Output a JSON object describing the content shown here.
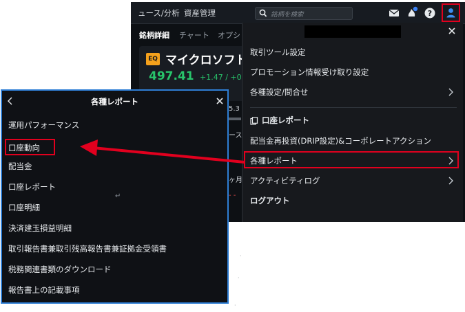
{
  "topbar": {
    "nav_items": [
      "ュース/分析",
      "資産管理"
    ],
    "search_placeholder": "銘柄を検索"
  },
  "subtabs": [
    "銘柄詳細",
    "チャート",
    "オプシ"
  ],
  "stock": {
    "badge": "EQ",
    "name": "マイクロソフト",
    "price": "497.41",
    "change": "+1.47 / +0.30"
  },
  "fragments": [
    "5.3",
    "ース",
    "ヶ月",
    "- -"
  ],
  "account_menu": {
    "items": [
      {
        "label": "取引ツール設定"
      },
      {
        "label": "プロモーション情報受け取り設定"
      },
      {
        "label": "各種設定/問合せ"
      }
    ],
    "section_title": "口座レポート",
    "section_items": [
      {
        "label": "配当金再投資(DRIP設定)&コーポレートアクション"
      },
      {
        "label": "各種レポート"
      },
      {
        "label": "アクティビティログ"
      }
    ],
    "logout": "ログアウト"
  },
  "reports_panel": {
    "title": "各種レポート",
    "items": [
      {
        "label": "運用パフォーマンス"
      },
      {
        "label": "口座動向"
      },
      {
        "label": "配当金"
      },
      {
        "label": "口座レポート"
      },
      {
        "label": "口座明細"
      },
      {
        "label": "決済建玉損益明細"
      },
      {
        "label": "取引報告書兼取引残高報告書兼証拠金受領書"
      },
      {
        "label": "税務関連書類のダウンロード"
      },
      {
        "label": "報告書上の記載事項"
      }
    ],
    "enter_glyph": "↵"
  },
  "colors": {
    "highlight": "#e1001e",
    "panel_border": "#2f7fd6",
    "price_green": "#28c46b",
    "badge_orange": "#f4a11c",
    "notification_dot": "#3b82f6"
  }
}
